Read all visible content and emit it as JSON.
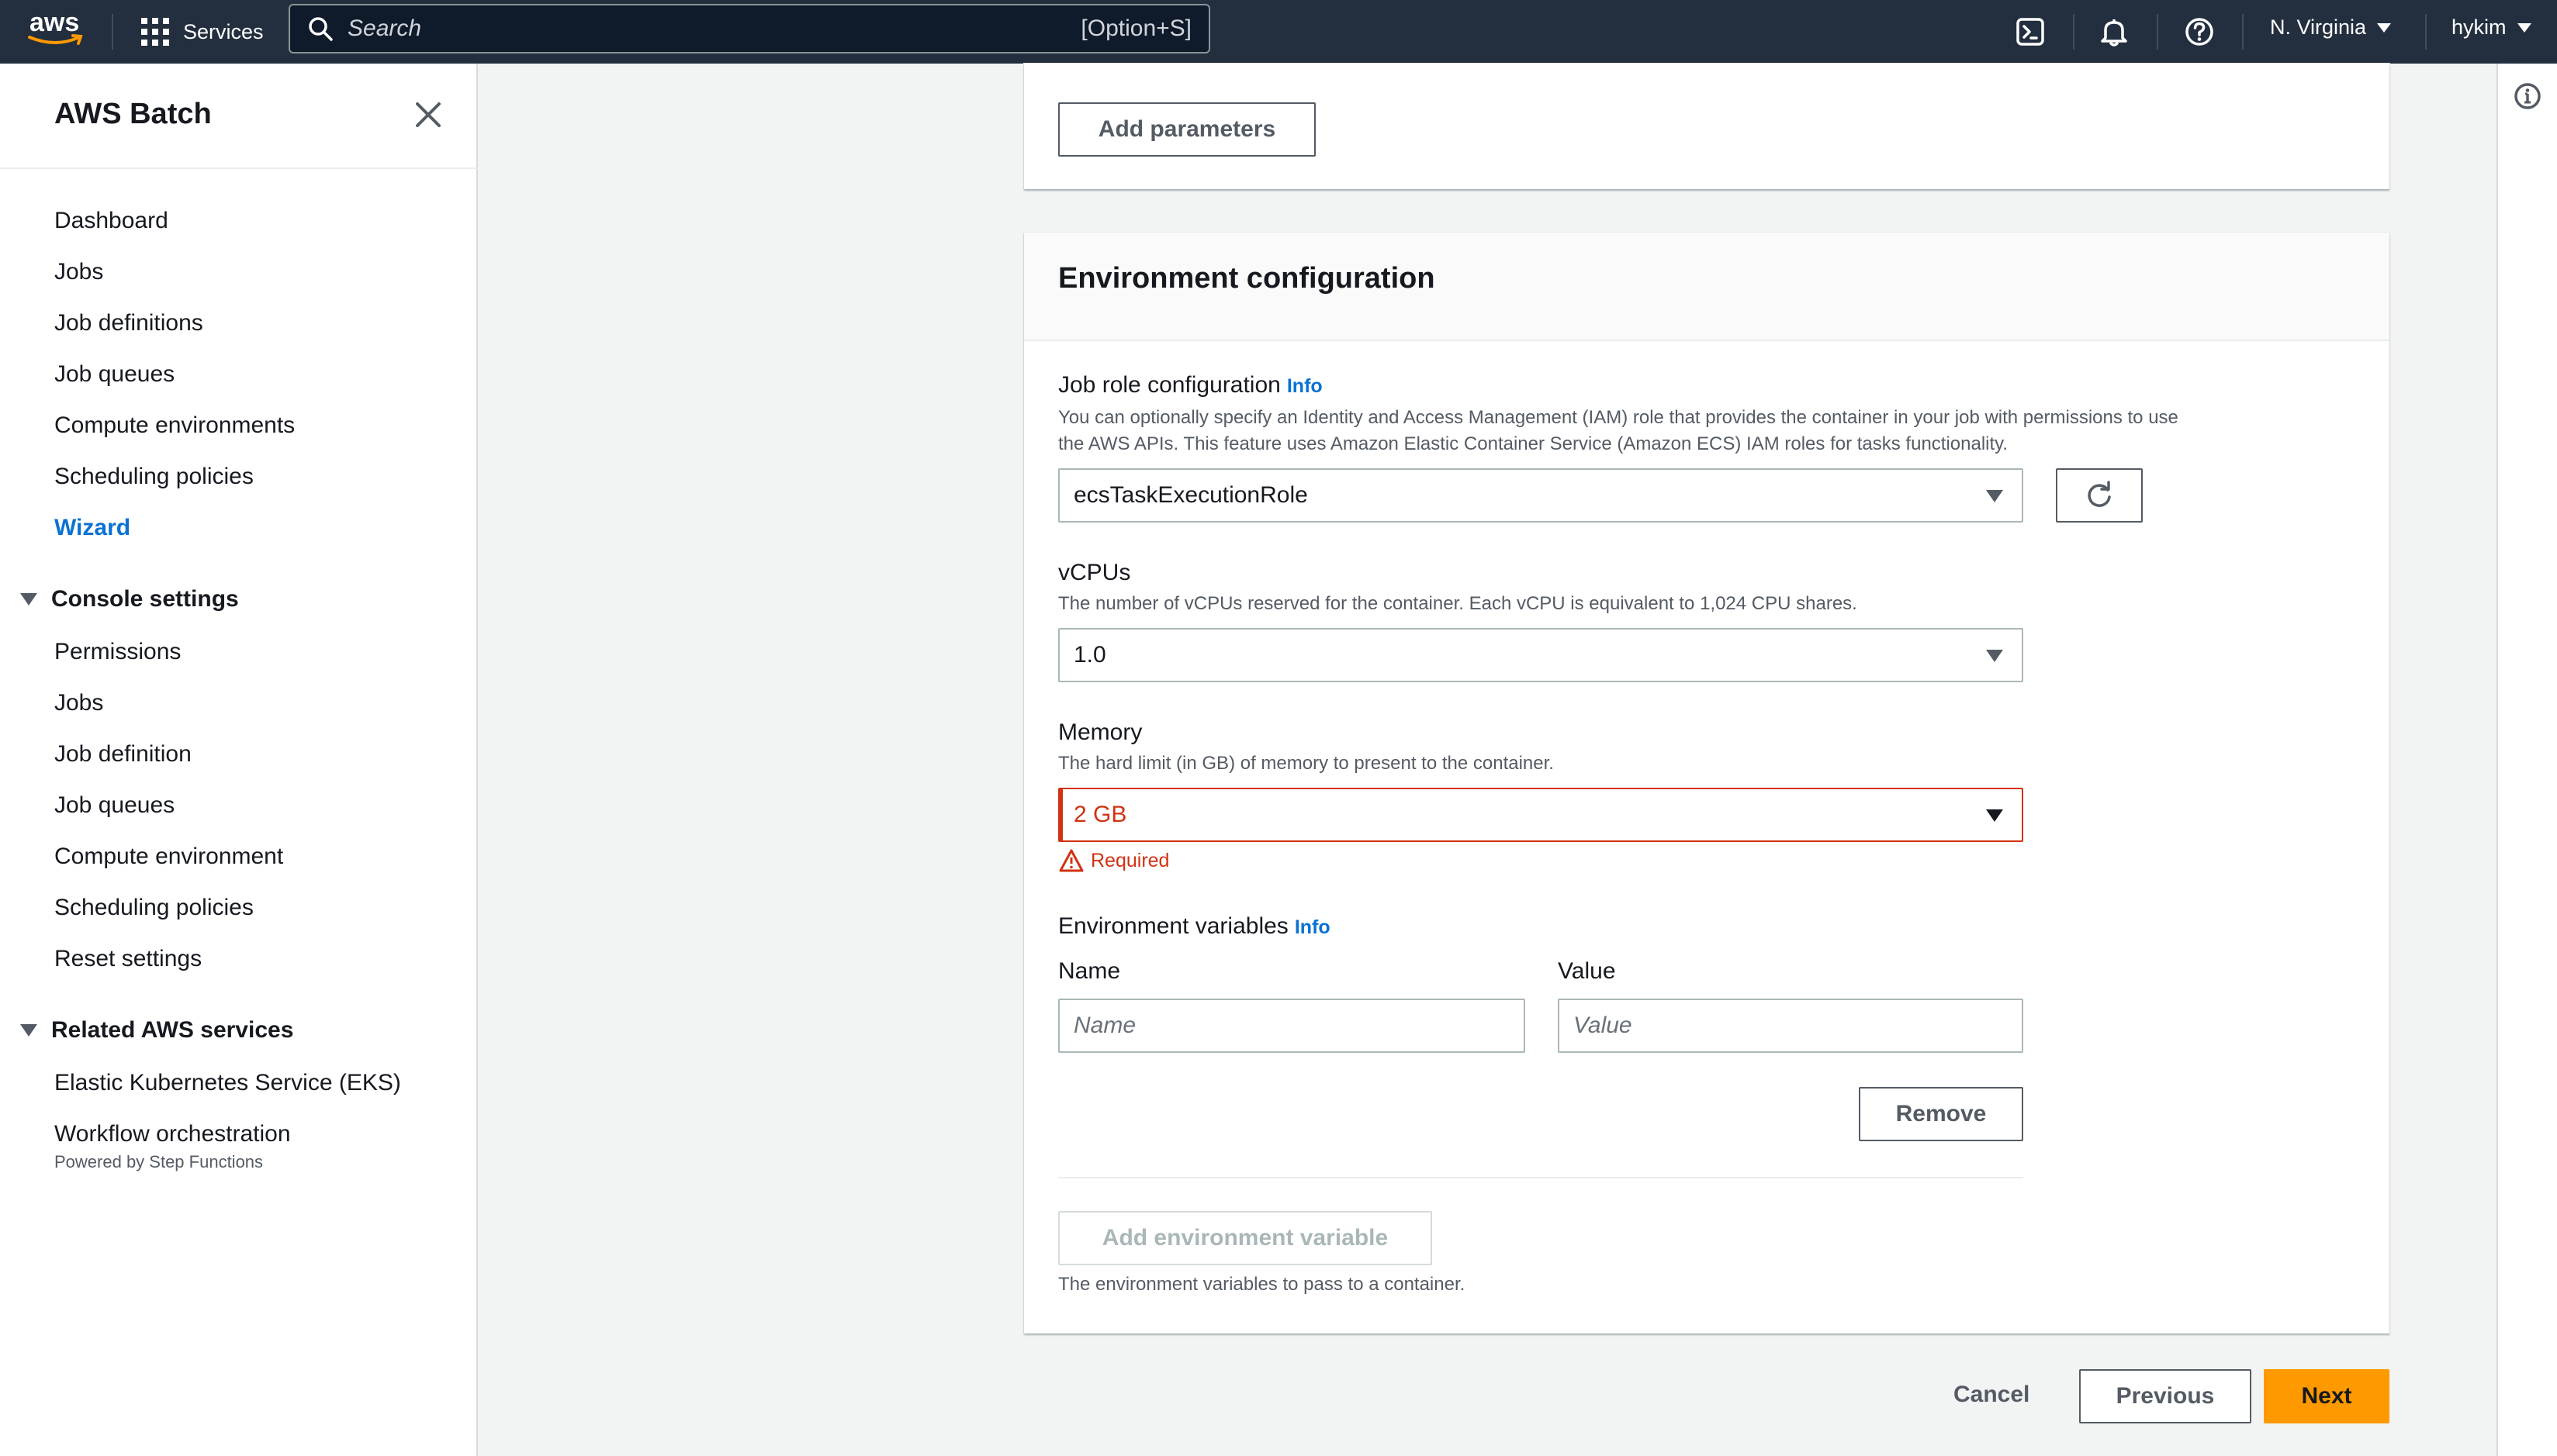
{
  "topnav": {
    "logo_text": "aws",
    "services_label": "Services",
    "search_placeholder": "Search",
    "search_shortcut": "[Option+S]",
    "region": "N. Virginia",
    "user": "hykim"
  },
  "sidebar": {
    "title": "AWS Batch",
    "items": [
      {
        "label": "Dashboard"
      },
      {
        "label": "Jobs"
      },
      {
        "label": "Job definitions"
      },
      {
        "label": "Job queues"
      },
      {
        "label": "Compute environments"
      },
      {
        "label": "Scheduling policies"
      },
      {
        "label": "Wizard",
        "active": true
      }
    ],
    "console_settings": {
      "label": "Console settings",
      "items": [
        {
          "label": "Permissions"
        },
        {
          "label": "Jobs"
        },
        {
          "label": "Job definition"
        },
        {
          "label": "Job queues"
        },
        {
          "label": "Compute environment"
        },
        {
          "label": "Scheduling policies"
        },
        {
          "label": "Reset settings"
        }
      ]
    },
    "related": {
      "label": "Related AWS services",
      "items": [
        {
          "label": "Elastic Kubernetes Service (EKS)"
        },
        {
          "label": "Workflow orchestration",
          "sub": "Powered by Step Functions"
        }
      ]
    }
  },
  "parameters_panel": {
    "add_button": "Add parameters"
  },
  "env_panel": {
    "title": "Environment configuration",
    "job_role": {
      "label": "Job role configuration",
      "info": "Info",
      "desc_line1": "You can optionally specify an Identity and Access Management (IAM) role that provides the container in your job with permissions to use",
      "desc_line2": "the AWS APIs. This feature uses Amazon Elastic Container Service (Amazon ECS) IAM roles for tasks functionality.",
      "value": "ecsTaskExecutionRole"
    },
    "vcpus": {
      "label": "vCPUs",
      "desc": "The number of vCPUs reserved for the container. Each vCPU is equivalent to 1,024 CPU shares.",
      "value": "1.0"
    },
    "memory": {
      "label": "Memory",
      "desc": "The hard limit (in GB) of memory to present to the container.",
      "value": "2 GB",
      "error": "Required"
    },
    "env_vars": {
      "label": "Environment variables",
      "info": "Info",
      "name_label": "Name",
      "value_label": "Value",
      "name_placeholder": "Name",
      "value_placeholder": "Value",
      "remove_button": "Remove",
      "add_button": "Add environment variable",
      "hint": "The environment variables to pass to a container."
    }
  },
  "footer": {
    "cancel": "Cancel",
    "previous": "Previous",
    "next": "Next"
  },
  "colors": {
    "nav_bg": "#232f3e",
    "link": "#0972d3",
    "error": "#d13212",
    "primary": "#ff9900"
  }
}
